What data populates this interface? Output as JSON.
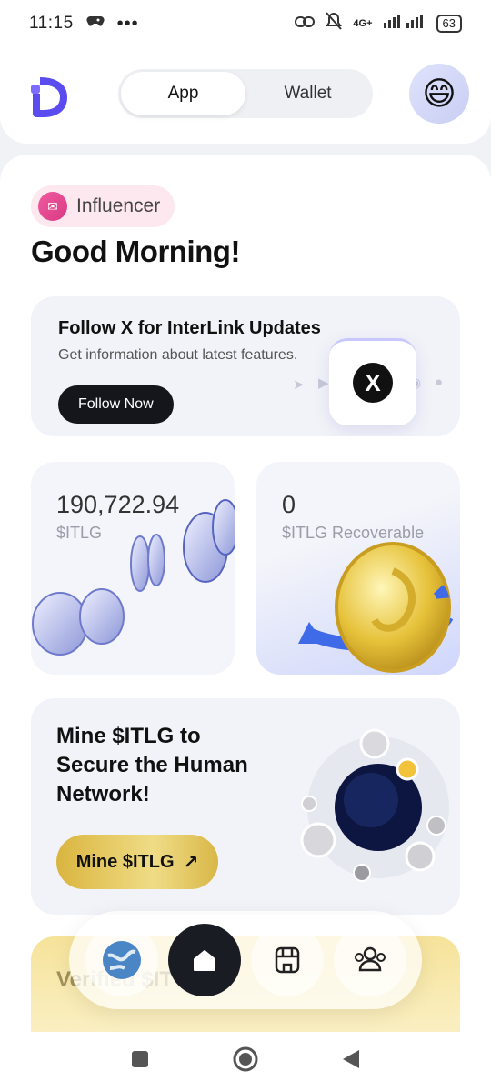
{
  "status": {
    "time": "11:15",
    "network": "4G+",
    "battery": "63"
  },
  "header": {
    "tabs": [
      {
        "label": "App",
        "active": true
      },
      {
        "label": "Wallet",
        "active": false
      }
    ],
    "avatar_icon": "smiley-face-icon"
  },
  "main": {
    "badge": "Influencer",
    "greeting": "Good Morning!",
    "follow_card": {
      "title": "Follow X for InterLink Updates",
      "subtitle": "Get information about latest features.",
      "button": "Follow Now",
      "logo": "X"
    },
    "balance_card": {
      "value": "190,722.94",
      "unit": "$ITLG"
    },
    "recoverable_card": {
      "value": "0",
      "unit": "$ITLG Recoverable"
    },
    "mine_card": {
      "title": "Mine $ITLG to Secure the Human Network!",
      "button": "Mine $ITLG"
    },
    "verified_card": {
      "text": "Verified $IT"
    }
  },
  "bottom_nav": [
    "globe-icon",
    "home-icon",
    "store-icon",
    "community-icon"
  ],
  "colors": {
    "accent": "#5b4cf0",
    "dark": "#14161c",
    "gold": "#e4c55a",
    "pink": "#f05aa0"
  }
}
